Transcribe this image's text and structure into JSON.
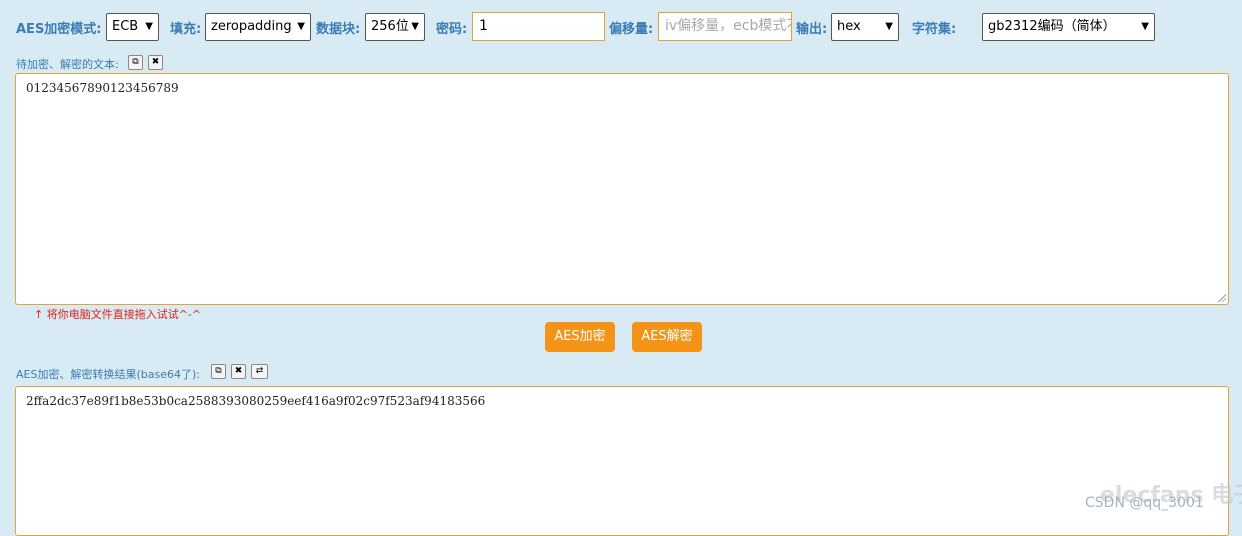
{
  "toolbar": {
    "mode_label": "AES加密模式:",
    "mode_value": "ECB",
    "padding_label": "填充:",
    "padding_value": "zeropadding",
    "block_label": "数据块:",
    "block_value": "256位",
    "key_label": "密码:",
    "key_value": "1",
    "iv_label": "偏移量:",
    "iv_placeholder": "iv偏移量，ecb模式不用填写",
    "output_label": "输出:",
    "output_value": "hex",
    "charset_label": "字符集:",
    "charset_value": "gb2312编码（简体）"
  },
  "input_section": {
    "label": "待加密、解密的文本:",
    "text": "01234567890123456789",
    "hint": "↑ 将你电脑文件直接拖入试试^-^"
  },
  "actions": {
    "encrypt_label": "AES加密",
    "decrypt_label": "AES解密"
  },
  "output_section": {
    "label": "AES加密、解密转换结果(base64了):",
    "text": "2ffa2dc37e89f1b8e53b0ca2588393080259eef416a9f02c97f523af94183566"
  },
  "watermark": {
    "logo": "elecfans 电子网",
    "text": "CSDN @qq_3001"
  },
  "icons": {
    "copy": "copy-icon",
    "clear": "clear-icon",
    "swap": "swap-icon",
    "dropdown": "chevron-down-icon"
  }
}
